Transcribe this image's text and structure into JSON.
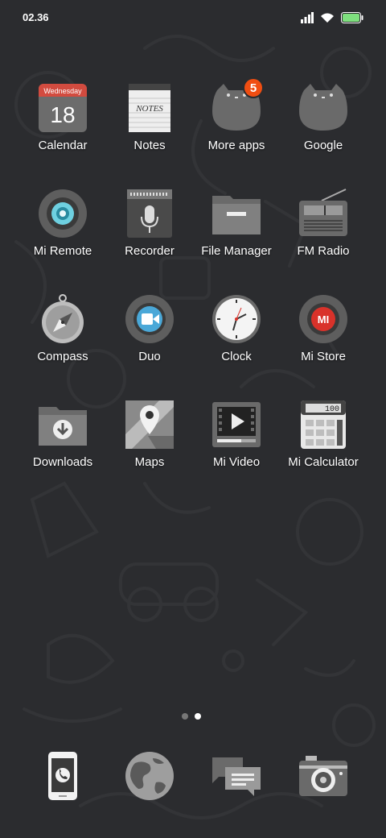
{
  "status_bar": {
    "time": "02.36",
    "icons": [
      "signal-icon",
      "wifi-icon",
      "battery-icon"
    ],
    "battery_color": "#7ee07e"
  },
  "apps": [
    {
      "label": "Calendar",
      "icon": "calendar-icon",
      "calendar_day": "Wednesday",
      "calendar_date": "18"
    },
    {
      "label": "Notes",
      "icon": "notes-icon",
      "notes_title": "NOTES"
    },
    {
      "label": "More apps",
      "icon": "folder-icon",
      "badge": "5"
    },
    {
      "label": "Google",
      "icon": "folder-icon"
    },
    {
      "label": "Mi Remote",
      "icon": "remote-icon"
    },
    {
      "label": "Recorder",
      "icon": "microphone-icon"
    },
    {
      "label": "File Manager",
      "icon": "file-folder-icon"
    },
    {
      "label": "FM Radio",
      "icon": "radio-icon"
    },
    {
      "label": "Compass",
      "icon": "compass-icon"
    },
    {
      "label": "Duo",
      "icon": "video-camera-icon"
    },
    {
      "label": "Clock",
      "icon": "clock-icon"
    },
    {
      "label": "Mi Store",
      "icon": "mi-store-icon",
      "store_logo": "MI"
    },
    {
      "label": "Downloads",
      "icon": "download-icon"
    },
    {
      "label": "Maps",
      "icon": "map-pin-icon"
    },
    {
      "label": "Mi Video",
      "icon": "play-icon"
    },
    {
      "label": "Mi Calculator",
      "icon": "calculator-icon",
      "calc_display": "100"
    }
  ],
  "pager": {
    "pages": 2,
    "active": 2
  },
  "dock": [
    {
      "icon": "phone-icon"
    },
    {
      "icon": "browser-globe-icon"
    },
    {
      "icon": "messages-icon"
    },
    {
      "icon": "camera-icon"
    }
  ],
  "colors": {
    "background": "#2b2c2f",
    "badge": "#f04e12",
    "mi_store_red": "#d9322a",
    "duo_blue": "#4aa8d8"
  }
}
